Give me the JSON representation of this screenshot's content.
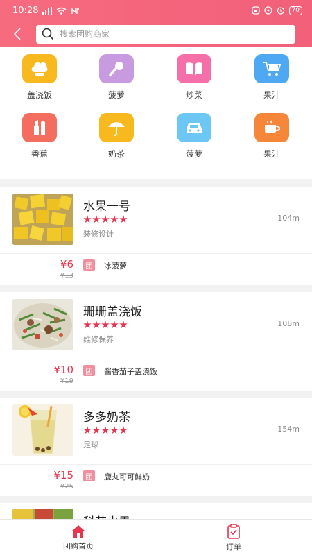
{
  "status": {
    "time": "10:28",
    "battery": "70"
  },
  "search": {
    "placeholder": "搜索团购商家"
  },
  "categories": [
    {
      "label": "盖浇饭",
      "icon": "chef-hat-icon",
      "color": "#f8b91f"
    },
    {
      "label": "菠萝",
      "icon": "microphone-icon",
      "color": "#c89be0"
    },
    {
      "label": "炒菜",
      "icon": "book-icon",
      "color": "#f570a8"
    },
    {
      "label": "果汁",
      "icon": "shopping-cart-icon",
      "color": "#4ea8f2"
    },
    {
      "label": "香蕉",
      "icon": "lipstick-icon",
      "color": "#f36e5f"
    },
    {
      "label": "奶茶",
      "icon": "umbrella-icon",
      "color": "#f8b91f"
    },
    {
      "label": "菠萝",
      "icon": "car-icon",
      "color": "#6cc7f5"
    },
    {
      "label": "果汁",
      "icon": "coffee-cup-icon",
      "color": "#f5863a"
    }
  ],
  "shops": [
    {
      "name": "水果一号",
      "category": "装修设计",
      "distance": "104m",
      "price": "¥6",
      "original_price": "¥13",
      "badge": "团",
      "deal": "冰菠萝",
      "rating": 5
    },
    {
      "name": "珊珊盖浇饭",
      "category": "维修保养",
      "distance": "108m",
      "price": "¥10",
      "original_price": "¥19",
      "badge": "团",
      "deal": "酱香茄子盖浇饭",
      "rating": 5
    },
    {
      "name": "多多奶茶",
      "category": "足球",
      "distance": "154m",
      "price": "¥15",
      "original_price": "¥25",
      "badge": "团",
      "deal": "鹿丸可可鲜奶",
      "rating": 5
    },
    {
      "name": "科苑水果"
    }
  ],
  "tabbar": {
    "home_label": "团购首页",
    "orders_label": "订单"
  },
  "colors": {
    "brand": "#f2607a",
    "accent": "#e8344e"
  }
}
